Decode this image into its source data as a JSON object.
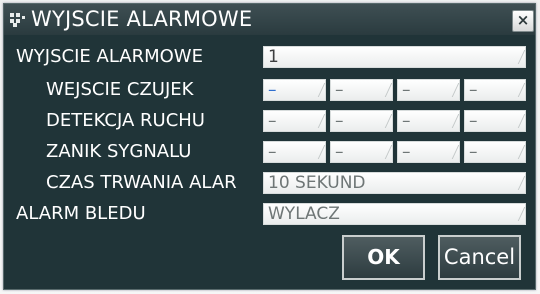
{
  "dialog": {
    "title": "WYJSCIE ALARMOWE",
    "close_label": "×"
  },
  "rows": {
    "output": {
      "label": "WYJSCIE ALARMOWE",
      "value": "1"
    },
    "sensor_input": {
      "label": "WEJSCIE CZUJEK",
      "values": [
        "–",
        "–",
        "–",
        "–"
      ]
    },
    "motion_detection": {
      "label": "DETEKCJA RUCHU",
      "values": [
        "–",
        "–",
        "–",
        "–"
      ]
    },
    "signal_loss": {
      "label": "ZANIK SYGNALU",
      "values": [
        "–",
        "–",
        "–",
        "–"
      ]
    },
    "alarm_duration": {
      "label": "CZAS TRWANIA ALAR",
      "value": "10 SEKUND"
    },
    "error_alarm": {
      "label": "ALARM BLEDU",
      "value": "WYLACZ"
    }
  },
  "buttons": {
    "ok": "OK",
    "cancel": "Cancel"
  },
  "colors": {
    "dialog_bg": "#203438",
    "titlebar": "#3f4f53",
    "focus_value": "#2f6fcf"
  }
}
